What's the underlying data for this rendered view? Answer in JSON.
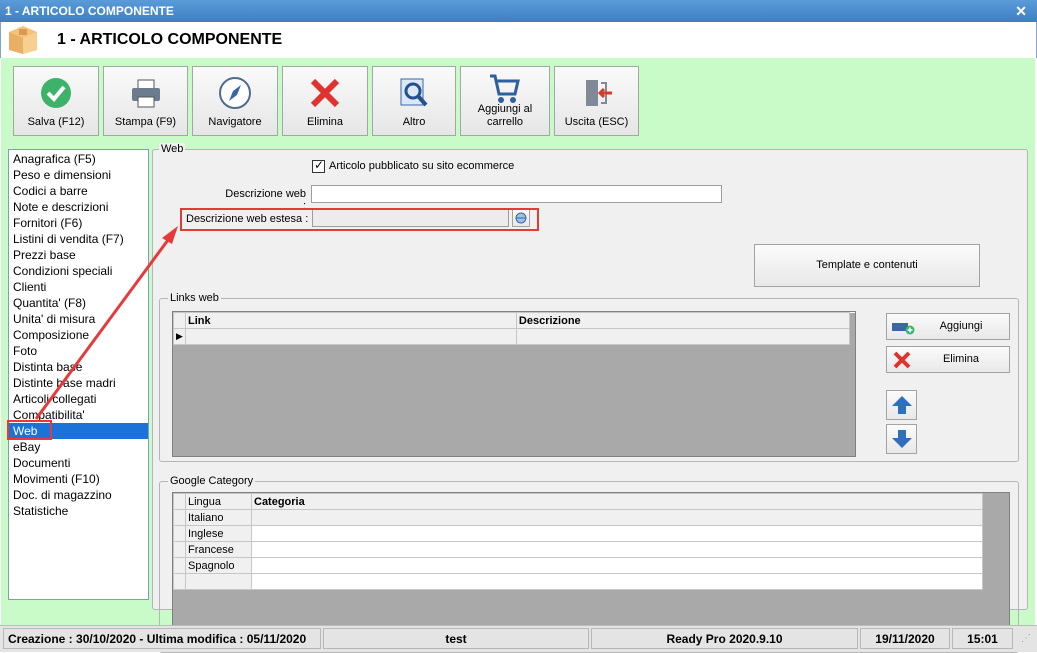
{
  "window": {
    "title": "1 - ARTICOLO COMPONENTE",
    "header_title": "1 - ARTICOLO COMPONENTE"
  },
  "toolbar": {
    "save": "Salva (F12)",
    "print": "Stampa (F9)",
    "navigator": "Navigatore",
    "delete": "Elimina",
    "other": "Altro",
    "add_to_cart_line1": "Aggiungi al",
    "add_to_cart_line2": "carrello",
    "exit": "Uscita (ESC)"
  },
  "nav": {
    "items": [
      "Anagrafica (F5)",
      "Peso e dimensioni",
      "Codici a barre",
      "Note e descrizioni",
      "Fornitori (F6)",
      "Listini di vendita (F7)",
      "Prezzi base",
      "Condizioni speciali",
      "Clienti",
      "Quantita' (F8)",
      "Unita' di misura",
      "Composizione",
      "Foto",
      "Distinta base",
      "Distinte base madri",
      "Articoli collegati",
      "Compatibilita'",
      "Web",
      "eBay",
      "Documenti",
      "Movimenti (F10)",
      "Doc. di magazzino",
      "Statistiche"
    ],
    "selected": "Web"
  },
  "web": {
    "group_label": "Web",
    "published_checkbox": "Articolo pubblicato su sito ecommerce",
    "published_checked": true,
    "web_description_label": "Descrizione web :",
    "web_description_value": "",
    "web_extended_label": "Descrizione web estesa :",
    "web_extended_value": "",
    "template_button": "Template e contenuti",
    "links_label": "Links web",
    "links_columns": [
      "Link",
      "Descrizione"
    ],
    "add_button": "Aggiungi",
    "delete_button": "Elimina",
    "google_label": "Google Category",
    "google_columns": [
      "Lingua",
      "Categoria"
    ],
    "google_rows": [
      {
        "lingua": "Italiano",
        "categoria": ""
      },
      {
        "lingua": "Inglese",
        "categoria": ""
      },
      {
        "lingua": "Francese",
        "categoria": ""
      },
      {
        "lingua": "Spagnolo",
        "categoria": ""
      }
    ]
  },
  "status": {
    "created": "Creazione : 30/10/2020 - Ultima modifica : 05/11/2020",
    "user": "test",
    "version": "Ready Pro 2020.9.10",
    "date": "19/11/2020",
    "time": "15:01"
  },
  "colors": {
    "accent_green": "#c8fbc8",
    "selection": "#1a73d9",
    "highlight": "#e8393a"
  }
}
